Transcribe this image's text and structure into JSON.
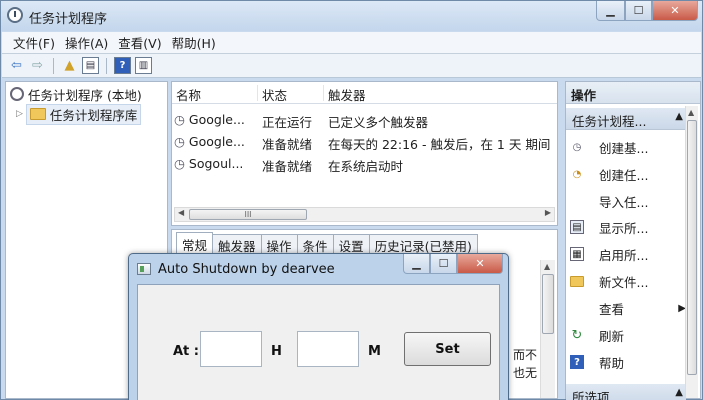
{
  "window": {
    "title": "任务计划程序",
    "min_label": "▁",
    "max_label": "☐",
    "close_label": "✕"
  },
  "menubar": {
    "items": [
      "文件(F)",
      "操作(A)",
      "查看(V)",
      "帮助(H)"
    ]
  },
  "toolbar": {
    "icons": [
      "back-icon",
      "forward-icon",
      "folder-up-icon",
      "show-hide-tree-icon",
      "help-icon",
      "show-hide-action-pane-icon"
    ]
  },
  "tree": {
    "root": "任务计划程序 (本地)",
    "child": "任务计划程序库"
  },
  "list": {
    "columns": [
      "名称",
      "状态",
      "触发器"
    ],
    "rows": [
      {
        "name": "Google...",
        "status": "正在运行",
        "trigger": "已定义多个触发器"
      },
      {
        "name": "Google...",
        "status": "准备就绪",
        "trigger": "在每天的 22:16 - 触发后，在 1 天 期间"
      },
      {
        "name": "Sogoul...",
        "status": "准备就绪",
        "trigger": "在系统启动时"
      }
    ],
    "scroll_grip": "III"
  },
  "detail": {
    "tabs": [
      "常规",
      "触发器",
      "操作",
      "条件",
      "设置",
      "历史记录(已禁用)"
    ],
    "behind_text_1": "而不",
    "behind_text_2": "也无"
  },
  "actions": {
    "header": "操作",
    "section1": "任务计划程...",
    "items": [
      {
        "label": "创建基...",
        "icon": "create-basic-task-icon"
      },
      {
        "label": "创建任...",
        "icon": "create-task-icon"
      },
      {
        "label": "导入任...",
        "icon": ""
      },
      {
        "label": "显示所...",
        "icon": "display-running-tasks-icon"
      },
      {
        "label": "启用所...",
        "icon": "enable-history-icon"
      },
      {
        "label": "新文件...",
        "icon": "new-folder-icon"
      },
      {
        "label": "查看",
        "icon": "",
        "submenu": true
      },
      {
        "label": "刷新",
        "icon": "refresh-icon"
      },
      {
        "label": "帮助",
        "icon": "help-icon"
      }
    ],
    "section2": "所选项"
  },
  "dialog": {
    "title": "Auto Shutdown by dearvee",
    "at_label": "At :",
    "h_label": "H",
    "m_label": "M",
    "hour_value": "",
    "minute_value": "",
    "set_label": "Set"
  }
}
